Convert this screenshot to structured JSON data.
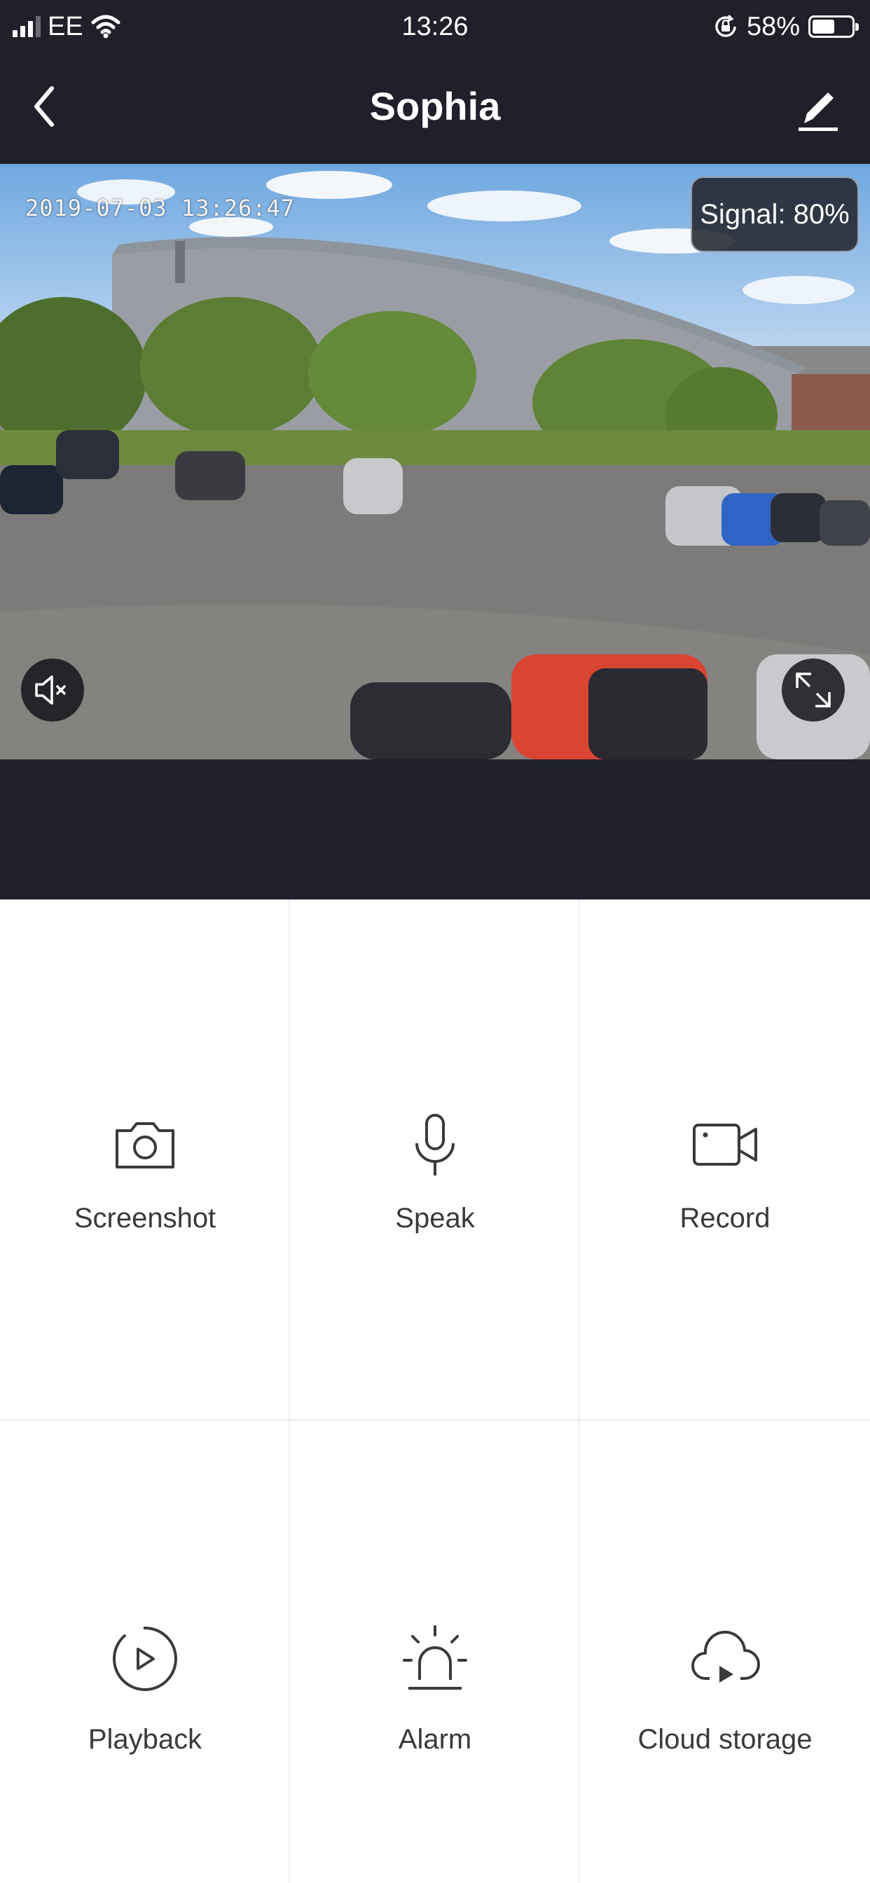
{
  "status_bar": {
    "carrier": "EE",
    "time": "13:26",
    "battery_percent": "58%",
    "battery_level": 0.58,
    "icons": [
      "signal-icon",
      "wifi-icon",
      "orientation-lock-icon",
      "battery-icon"
    ]
  },
  "nav": {
    "title": "Sophia",
    "back_icon": "chevron-left-icon",
    "edit_icon": "pencil-icon"
  },
  "video": {
    "timestamp": "2019-07-03 13:26:47",
    "signal_label": "Signal: 80%",
    "mute_icon": "speaker-muted-icon",
    "fullscreen_icon": "expand-icon"
  },
  "actions": [
    {
      "label": "Screenshot",
      "icon": "camera-icon"
    },
    {
      "label": "Speak",
      "icon": "microphone-icon"
    },
    {
      "label": "Record",
      "icon": "video-camera-icon"
    },
    {
      "label": "Playback",
      "icon": "playback-icon"
    },
    {
      "label": "Alarm",
      "icon": "siren-icon"
    },
    {
      "label": "Cloud storage",
      "icon": "cloud-play-icon"
    }
  ],
  "colors": {
    "header_bg": "#1f2029",
    "text_dark": "#3a3a3a",
    "divider": "#ededed"
  }
}
